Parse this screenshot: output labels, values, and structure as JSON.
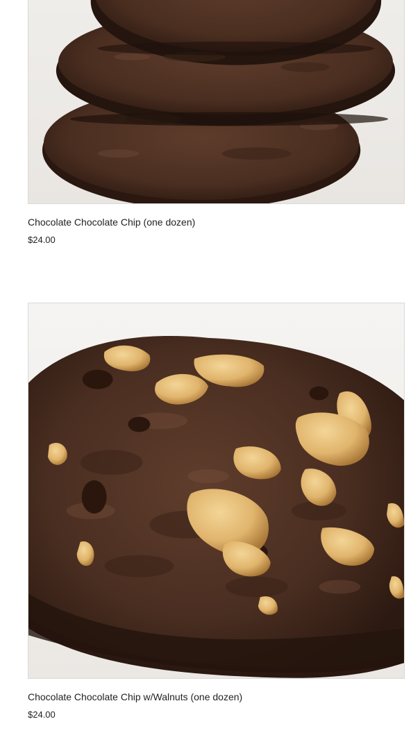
{
  "products": [
    {
      "name": "Chocolate Chocolate Chip (one dozen)",
      "price": "$24.00",
      "image_icon": "stacked-chocolate-cookies-photo"
    },
    {
      "name": "Chocolate Chocolate Chip w/Walnuts (one dozen)",
      "price": "$24.00",
      "image_icon": "chocolate-walnut-cookie-photo"
    }
  ],
  "colors": {
    "text": "#222222",
    "image_border": "#d9d9d9",
    "cookie_dark": "#3a2418",
    "cookie_mid": "#5a3a2a",
    "walnut": "#d9a860"
  }
}
